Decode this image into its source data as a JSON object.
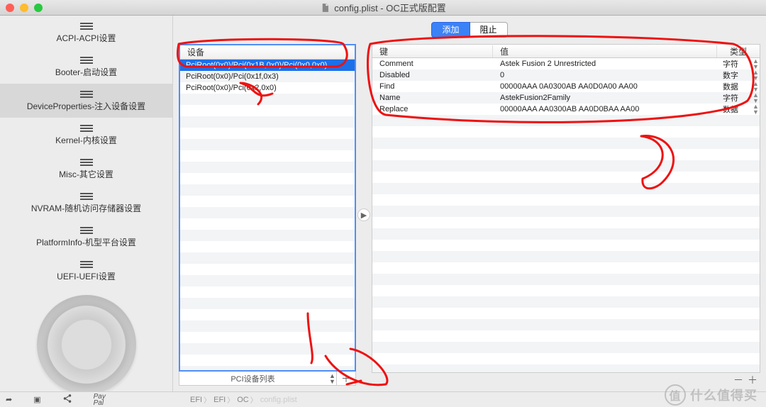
{
  "window": {
    "title": "config.plist - OC正式版配置"
  },
  "sidebar": {
    "items": [
      {
        "label": "ACPI-ACPI设置"
      },
      {
        "label": "Booter-启动设置"
      },
      {
        "label": "DeviceProperties-注入设备设置"
      },
      {
        "label": "Kernel-内核设置"
      },
      {
        "label": "Misc-其它设置"
      },
      {
        "label": "NVRAM-随机访问存储器设置"
      },
      {
        "label": "PlatformInfo-机型平台设置"
      },
      {
        "label": "UEFI-UEFI设置"
      }
    ]
  },
  "top": {
    "add": "添加",
    "block": "阻止"
  },
  "left_table": {
    "header": "设备",
    "rows": [
      "PciRoot(0x0)/Pci(0x1B,0x0)/Pci(0x0,0x0)",
      "PciRoot(0x0)/Pci(0x1f,0x3)",
      "PciRoot(0x0)/Pci(0x2,0x0)"
    ],
    "footer_label": "PCI设备列表"
  },
  "right_table": {
    "cols": {
      "key": "键",
      "val": "值",
      "type": "类型"
    },
    "rows": [
      {
        "k": "Comment",
        "v": "Astek Fusion 2 Unrestricted",
        "t": "字符"
      },
      {
        "k": "Disabled",
        "v": "0",
        "t": "数字"
      },
      {
        "k": "Find",
        "v": "00000AAA 0A0300AB AA0D0A00 AA00",
        "t": "数据"
      },
      {
        "k": "Name",
        "v": "AstekFusion2Family",
        "t": "字符"
      },
      {
        "k": "Replace",
        "v": "00000AAA AA0300AB AA0D0BAA AA00",
        "t": "数据"
      }
    ]
  },
  "breadcrumb": [
    "EFI",
    "EFI",
    "OC",
    "config.plist"
  ],
  "bottom_icons": {
    "paypal": "PayPal"
  },
  "watermark": "什么值得买"
}
